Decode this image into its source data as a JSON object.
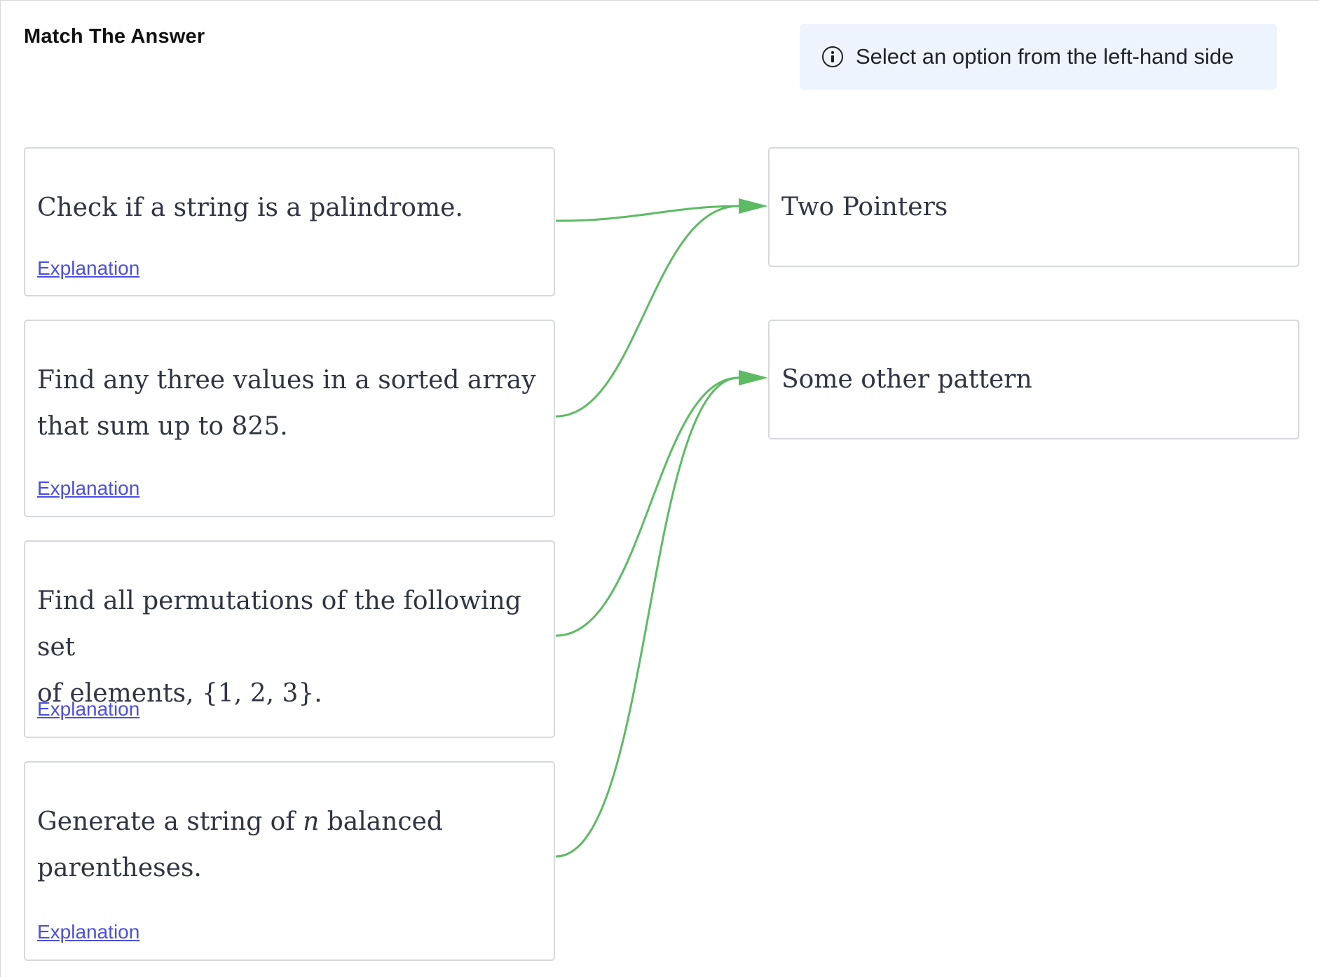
{
  "header": {
    "title": "Match The Answer",
    "info_icon": "info-circle-icon",
    "info_text": "Select an option from the left-hand side"
  },
  "questions": [
    {
      "lines": [
        "Check if a string is a palindrome."
      ],
      "explanation_label": "Explanation",
      "matched_answer": "Two Pointers"
    },
    {
      "lines": [
        "Find any three values in a sorted array",
        "that sum up to 825."
      ],
      "explanation_label": "Explanation",
      "matched_answer": "Two Pointers"
    },
    {
      "lines": [
        "Find all permutations of the following set",
        "of elements, {1, 2, 3}."
      ],
      "explanation_label": "Explanation",
      "matched_answer": "Some other pattern"
    },
    {
      "line1_before": "Generate a string of ",
      "line1_math": "n",
      "line1_after": " balanced",
      "line2": "parentheses.",
      "explanation_label": "Explanation",
      "matched_answer": "Some other pattern"
    }
  ],
  "answers": [
    {
      "label": "Two Pointers"
    },
    {
      "label": "Some other pattern"
    }
  ],
  "connector_color": "#5dbb63"
}
